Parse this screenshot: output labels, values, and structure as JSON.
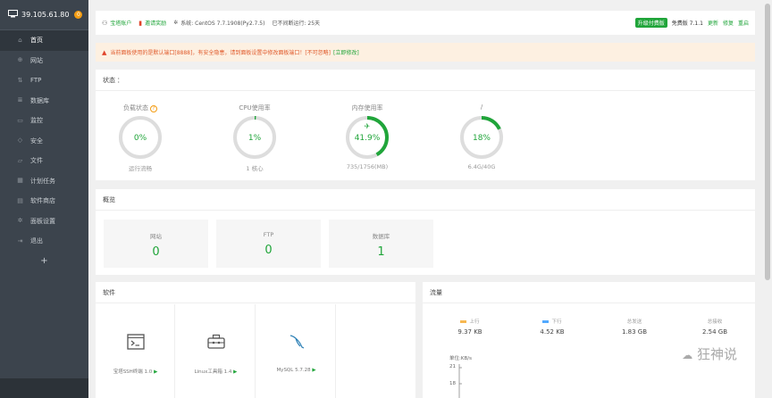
{
  "sidebar": {
    "ip": "39.105.61.80",
    "badge": "0",
    "items": [
      {
        "label": "首页",
        "icon": "home-icon",
        "glyph": "⌂"
      },
      {
        "label": "网站",
        "icon": "globe-icon",
        "glyph": "⊕"
      },
      {
        "label": "FTP",
        "icon": "ftp-icon",
        "glyph": "⇅"
      },
      {
        "label": "数据库",
        "icon": "database-icon",
        "glyph": "≣"
      },
      {
        "label": "监控",
        "icon": "monitor-icon",
        "glyph": "▭"
      },
      {
        "label": "安全",
        "icon": "shield-icon",
        "glyph": "◇"
      },
      {
        "label": "文件",
        "icon": "folder-icon",
        "glyph": "▱"
      },
      {
        "label": "计划任务",
        "icon": "calendar-icon",
        "glyph": "▦"
      },
      {
        "label": "软件商店",
        "icon": "store-icon",
        "glyph": "▤"
      },
      {
        "label": "面板设置",
        "icon": "gear-icon",
        "glyph": "✲"
      },
      {
        "label": "退出",
        "icon": "logout-icon",
        "glyph": "⇥"
      }
    ],
    "add": "+"
  },
  "topbar": {
    "account": "宝塔账户",
    "claim": "邀请奖励",
    "system": "系统:  CentOS 7.7.1908(Py2.7.5)",
    "uptime": "已不间断运行: 25天",
    "upgrade": "升级付费版",
    "version": "免费版  7.1.1",
    "update": "更新",
    "repair": "修复",
    "restart": "重启"
  },
  "warning": {
    "text": "当前面板使用的是默认端口[8888]，有安全隐患，请到面板设置中修改面板端口！[不可忽略]",
    "link": "[立即修改]"
  },
  "status": {
    "title": "状态",
    "gauges": [
      {
        "label": "负载状态",
        "value": "0%",
        "sub": "运行流畅",
        "pct": 0
      },
      {
        "label": "CPU使用率",
        "value": "1%",
        "sub": "1 核心",
        "pct": 1
      },
      {
        "label": "内存使用率",
        "value": "41.9%",
        "sub": "735/1756(MB)",
        "pct": 41.9
      },
      {
        "label": "/",
        "value": "18%",
        "sub": "6.4G/40G",
        "pct": 18
      }
    ]
  },
  "overview": {
    "title": "概览",
    "cards": [
      {
        "label": "网站",
        "value": "0"
      },
      {
        "label": "FTP",
        "value": "0"
      },
      {
        "label": "数据库",
        "value": "1"
      }
    ]
  },
  "software": {
    "title": "软件",
    "items": [
      {
        "name": "宝塔SSH终端 1.0",
        "icon": "terminal-icon"
      },
      {
        "name": "Linux工具箱 1.4",
        "icon": "toolbox-icon"
      },
      {
        "name": "MySQL 5.7.28",
        "icon": "mysql-dolphin-icon"
      }
    ],
    "play": "▶"
  },
  "traffic": {
    "title": "流量",
    "cols": [
      {
        "label": "上行",
        "value": "9.37 KB",
        "color": "#f7b851"
      },
      {
        "label": "下行",
        "value": "4.52 KB",
        "color": "#52a9ff"
      },
      {
        "label": "总发送",
        "value": "1.83 GB"
      },
      {
        "label": "总接收",
        "value": "2.54 GB"
      }
    ],
    "unit": "单位:KB/s",
    "ticks": [
      "21",
      "18"
    ]
  },
  "watermark": "狂神说",
  "colors": {
    "accent": "#20a53a",
    "sidebar": "#3c444d",
    "warning": "#e05a2b"
  }
}
